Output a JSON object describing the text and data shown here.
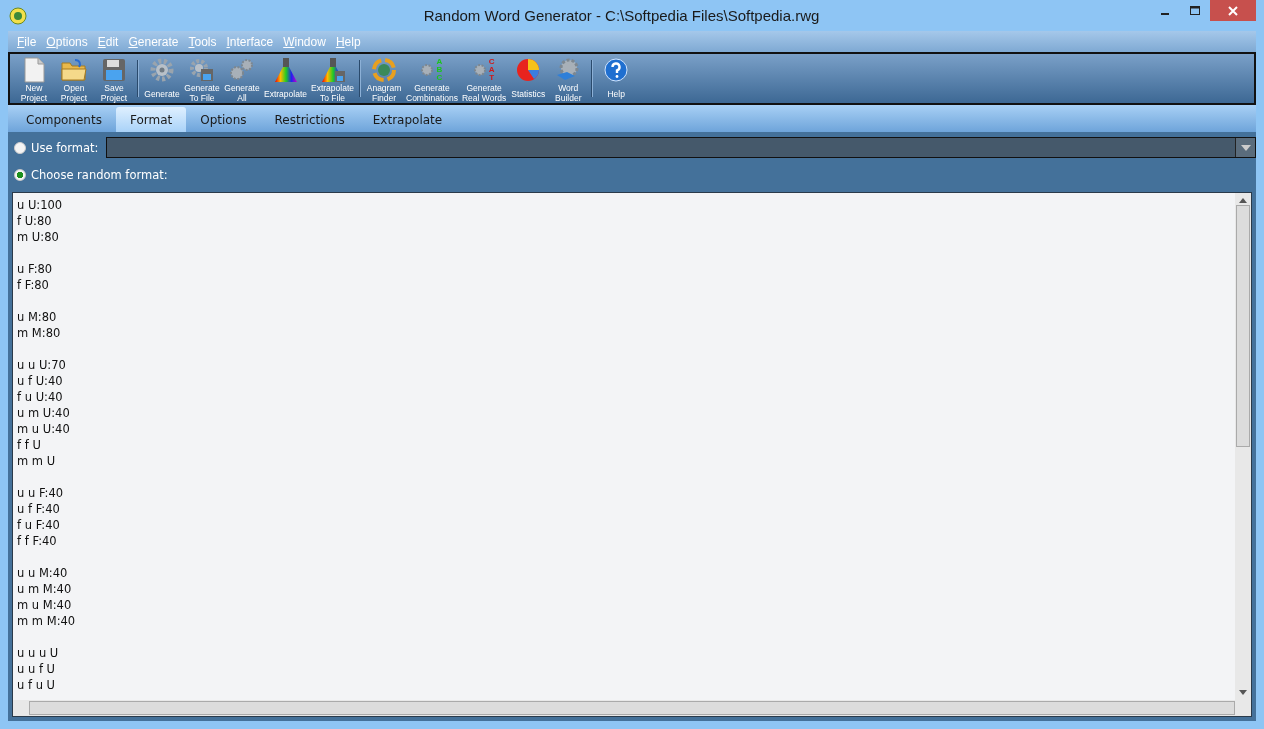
{
  "window": {
    "title": "Random Word Generator - C:\\Softpedia Files\\Softpedia.rwg"
  },
  "menu": [
    "File",
    "Options",
    "Edit",
    "Generate",
    "Tools",
    "Interface",
    "Window",
    "Help"
  ],
  "toolbar": [
    {
      "kind": "document",
      "lines": [
        "New",
        "Project"
      ],
      "separator_before": false
    },
    {
      "kind": "folder",
      "lines": [
        "Open",
        "Project"
      ],
      "separator_before": false
    },
    {
      "kind": "floppy",
      "lines": [
        "Save",
        "Project"
      ],
      "separator_before": false
    },
    {
      "kind": "gear",
      "lines": [
        "Generate"
      ],
      "separator_before": true
    },
    {
      "kind": "gear-floppy",
      "lines": [
        "Generate",
        "To File"
      ],
      "separator_before": false
    },
    {
      "kind": "gears",
      "lines": [
        "Generate",
        "All"
      ],
      "separator_before": false
    },
    {
      "kind": "prism",
      "lines": [
        "Extrapolate"
      ],
      "separator_before": false
    },
    {
      "kind": "prism-floppy",
      "lines": [
        "Extrapolate",
        "To File"
      ],
      "separator_before": false
    },
    {
      "kind": "arrows",
      "lines": [
        "Anagram",
        "Finder"
      ],
      "separator_before": true
    },
    {
      "kind": "gear-letters",
      "badge": "ABC",
      "lines": [
        "Generate",
        "Combinations"
      ],
      "separator_before": false
    },
    {
      "kind": "gear-letters",
      "badge": "CAT",
      "lines": [
        "Generate",
        "Real Words"
      ],
      "separator_before": false
    },
    {
      "kind": "pie",
      "lines": [
        "Statistics"
      ],
      "separator_before": false
    },
    {
      "kind": "gear-book",
      "lines": [
        "Word",
        "Builder"
      ],
      "separator_before": false
    },
    {
      "kind": "help",
      "lines": [
        "Help"
      ],
      "separator_before": true
    }
  ],
  "tabs": [
    {
      "label": "Components",
      "selected": false
    },
    {
      "label": "Format",
      "selected": true
    },
    {
      "label": "Options",
      "selected": false
    },
    {
      "label": "Restrictions",
      "selected": false
    },
    {
      "label": "Extrapolate",
      "selected": false
    }
  ],
  "format_options": [
    {
      "label": "Use format:",
      "selected": false,
      "kind": "combo"
    },
    {
      "label": "Choose random format:",
      "selected": true,
      "kind": "plain"
    }
  ],
  "format_text": [
    [
      "u U:100",
      "f U:80",
      "m U:80"
    ],
    [
      "u F:80",
      "f F:80"
    ],
    [
      "u M:80",
      "m M:80"
    ],
    [
      "u u U:70",
      "u f U:40",
      "f u U:40",
      "u m U:40",
      "m u U:40",
      "f f U",
      "m m U"
    ],
    [
      "u u F:40",
      "u f F:40",
      "f u F:40",
      "f f F:40"
    ],
    [
      "u u M:40",
      "u m M:40",
      "m u M:40",
      "m m M:40"
    ],
    [
      "u u u U",
      "u u f U",
      "u f u U"
    ]
  ]
}
